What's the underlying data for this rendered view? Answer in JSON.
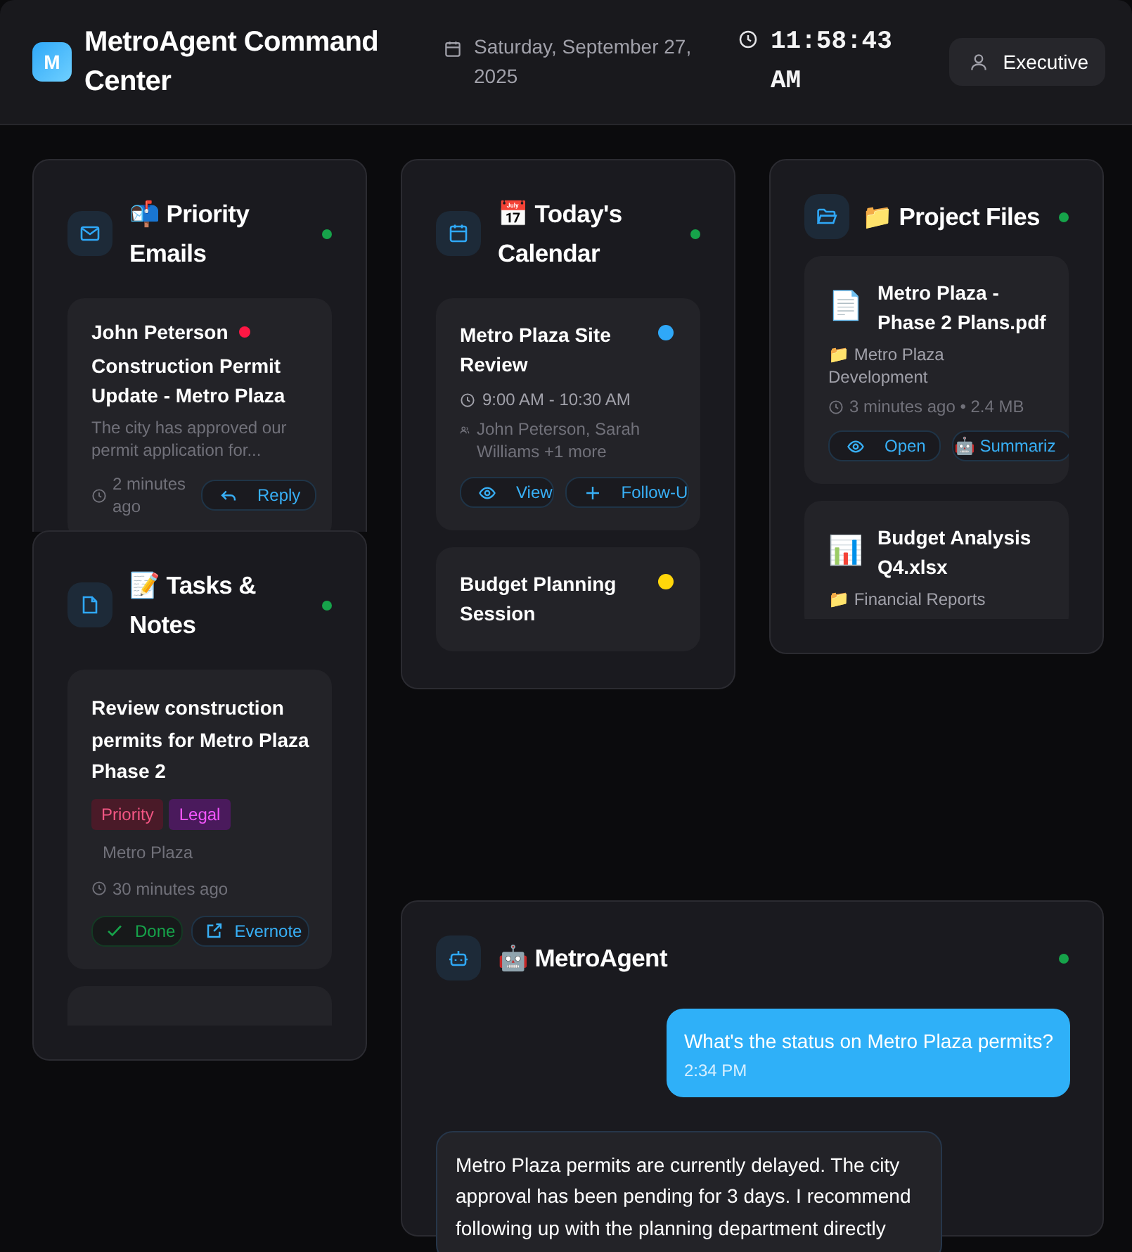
{
  "header": {
    "logo": "M",
    "title": "MetroAgent Command Center",
    "date": "Saturday, September 27, 2025",
    "time": "11:58:43 AM",
    "user": "Executive"
  },
  "emails": {
    "title": "📬 Priority Emails",
    "online": true,
    "items": [
      {
        "sender": "John Peterson",
        "color": "#ff1744",
        "subject": "Construction Permit Update - Metro Plaza",
        "preview": "The city has approved our permit application for...",
        "time": "2 minutes ago",
        "actions": [
          {
            "label": "Reply",
            "kind": "reply"
          }
        ]
      }
    ]
  },
  "tasks": {
    "title": "📝 Tasks & Notes",
    "online": true,
    "items": [
      {
        "kind": "task",
        "title": "Review construction permits for Metro Plaza Phase 2",
        "tags": [
          {
            "label": "Priority",
            "color": "#4a1a28"
          },
          {
            "label": "Legal",
            "color": "#4a1a5c"
          }
        ],
        "project": "Metro Plaza",
        "time": "30 minutes ago",
        "actions": [
          {
            "label": "Done",
            "kind": "done"
          },
          {
            "label": "Evernote",
            "kind": "export"
          }
        ]
      },
      {
        "kind": "blank"
      }
    ]
  },
  "calendar": {
    "title": "📅 Today's Calendar",
    "online": true,
    "items": [
      {
        "title": "Metro Plaza Site Review",
        "color": "#2fa8f8",
        "time": "9:00 AM - 10:30 AM",
        "people": "John Peterson, Sarah Williams +1 more",
        "actions": [
          {
            "label": "View",
            "kind": "view"
          },
          {
            "label": "Follow-U",
            "kind": "add"
          }
        ]
      },
      {
        "title": "Budget Planning Session",
        "color": "#ffd60a"
      }
    ]
  },
  "files": {
    "title": "📁 Project Files",
    "online": true,
    "items": [
      {
        "icon": "📄",
        "name": "Metro Plaza - Phase 2 Plans.pdf",
        "folder": "📁 Metro Plaza Development",
        "meta": "3 minutes ago • 2.4 MB",
        "actions": [
          {
            "label": "Open",
            "kind": "view"
          },
          {
            "label": "🤖 Summariz",
            "kind": "summarize"
          }
        ]
      },
      {
        "icon": "📊",
        "name": "Budget Analysis Q4.xlsx",
        "folder": "📁 Financial Reports"
      }
    ]
  },
  "chat": {
    "title": "🤖 MetroAgent",
    "online": true,
    "messages": [
      {
        "kind": "sent",
        "text": "What's the status on Metro Plaza permits?",
        "time": "2:34 PM"
      },
      {
        "kind": "received",
        "text": "Metro Plaza permits are currently delayed. The city approval has been pending for 3 days. I recommend following up with the planning department directly"
      }
    ]
  }
}
